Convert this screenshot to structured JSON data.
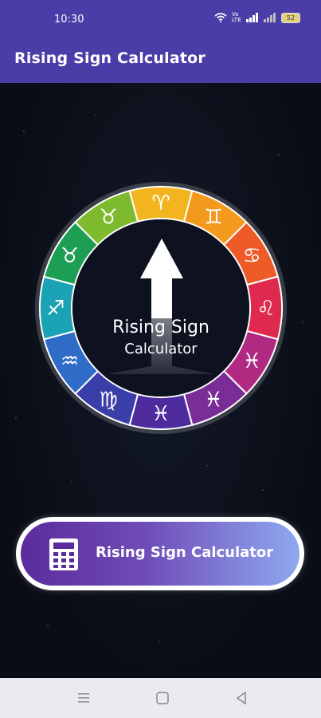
{
  "status": {
    "time": "10:30",
    "network": "Vo LTE",
    "battery": "52"
  },
  "appbar": {
    "title": "Rising Sign Calculator"
  },
  "wheel": {
    "center_line1": "Rising Sign",
    "center_line2": "Calculator",
    "segments": [
      {
        "sign": "aries-icon",
        "glyph": "♈",
        "color": "#F2B51F"
      },
      {
        "sign": "gemini-icon",
        "glyph": "♊",
        "color": "#F39A1E"
      },
      {
        "sign": "cancer-icon",
        "glyph": "♋",
        "color": "#EE5B28"
      },
      {
        "sign": "leo-icon",
        "glyph": "♌",
        "color": "#DF2A50"
      },
      {
        "sign": "pisces-icon",
        "glyph": "♓",
        "color": "#B02A82"
      },
      {
        "sign": "sagittarius-glyph-icon",
        "glyph": "♓",
        "color": "#7A2C97"
      },
      {
        "sign": "pisces-bottom-icon",
        "glyph": "♓",
        "color": "#4E2C9E"
      },
      {
        "sign": "virgo-icon",
        "glyph": "♍",
        "color": "#3A3EA8"
      },
      {
        "sign": "aquarius-icon",
        "glyph": "♒",
        "color": "#2E6CC8"
      },
      {
        "sign": "sagittarius-icon",
        "glyph": "♐",
        "color": "#1AA2B5"
      },
      {
        "sign": "taurus-icon",
        "glyph": "♉",
        "color": "#1E9E55"
      },
      {
        "sign": "taurus-top-icon",
        "glyph": "♉",
        "color": "#7DBA2E"
      }
    ]
  },
  "cta": {
    "label": "Rising Sign Calculator"
  }
}
